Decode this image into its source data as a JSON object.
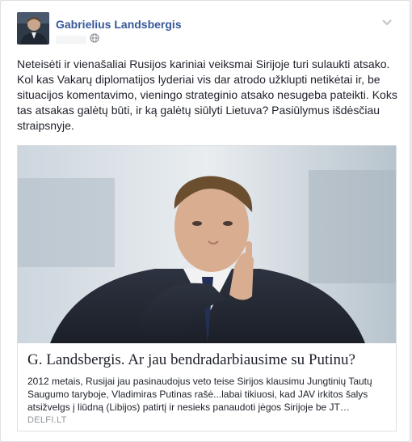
{
  "post": {
    "author": "Gabrielius Landsbergis",
    "privacy_icon": "globe-icon",
    "options_icon": "chevron-down-icon",
    "text": "Neteisėti ir vienašaliai Rusijos kariniai veiksmai Sirijoje turi sulaukti atsako. Kol kas Vakarų diplomatijos lyderiai vis dar atrodo užklupti netikėtai ir, be situacijos komentavimo, vieningo strateginio atsako nesugeba pateikti. Koks tas atsakas galėtų būti, ir ką galėtų siūlyti Lietuva? Pasiūlymus išdėsčiau straipsnyje."
  },
  "link": {
    "title": "G. Landsbergis. Ar jau bendradarbiausime su Putinu?",
    "description": "2012 metais, Rusijai jau pasinaudojus veto teise Sirijos klausimu Jungtinių Tautų Saugumo taryboje, Vladimiras Putinas rašė...labai tikiuosi, kad JAV irkitos šalys atsižvelgs į liūdną (Libijos) patirtį ir nesieks panaudoti jėgos Sirijoje be JT…",
    "domain": "DELFI.LT"
  },
  "colors": {
    "author_link": "#365899",
    "text": "#1d2129",
    "muted": "#90949c",
    "border": "#dddfe2"
  }
}
